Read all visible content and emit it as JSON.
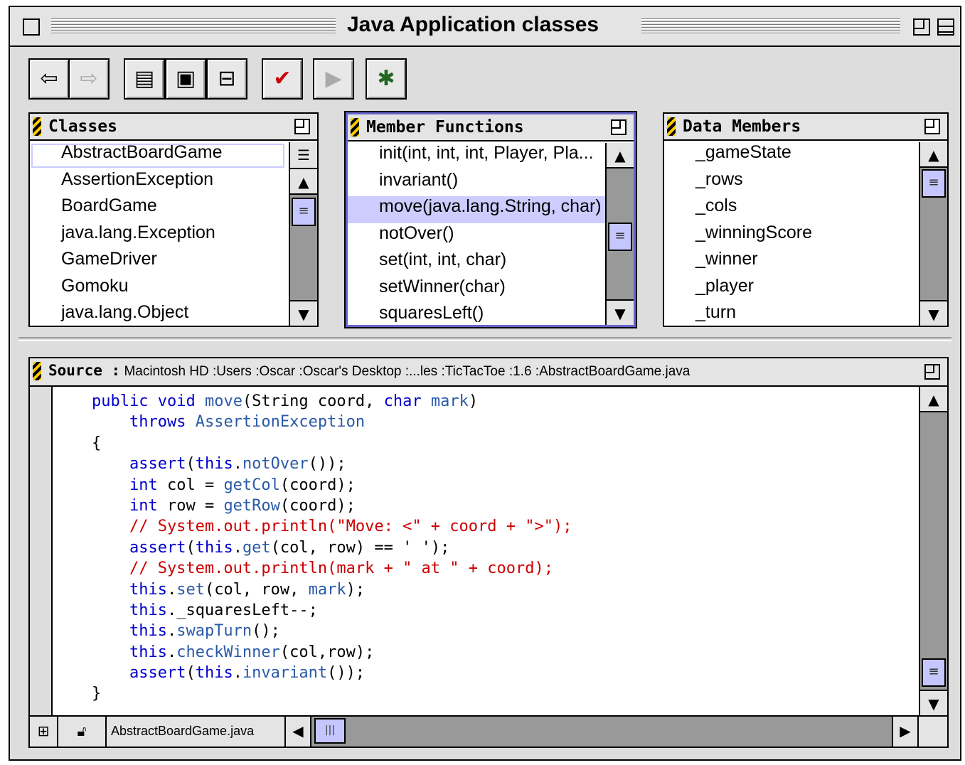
{
  "window": {
    "title": "Java Application classes"
  },
  "toolbar": {
    "buttons": [
      {
        "name": "back-button",
        "icon": "arrow-left-icon",
        "enabled": true
      },
      {
        "name": "forward-button",
        "icon": "arrow-right-icon",
        "enabled": false
      },
      {
        "name": "class-browser-button",
        "icon": "class-browser-icon",
        "enabled": true
      },
      {
        "name": "hierarchy-button",
        "icon": "hierarchy-icon",
        "enabled": true
      },
      {
        "name": "layout-button",
        "icon": "layout-icon",
        "enabled": true
      },
      {
        "name": "checklist-button",
        "icon": "checklist-icon",
        "enabled": true
      },
      {
        "name": "record-button",
        "icon": "record-icon",
        "enabled": false
      },
      {
        "name": "bug-button",
        "icon": "bug-icon",
        "enabled": true
      }
    ]
  },
  "classes": {
    "header": "Classes",
    "items": [
      "AbstractBoardGame",
      "AssertionException",
      "BoardGame",
      "java.lang.Exception",
      "GameDriver",
      "Gomoku",
      "java.lang.Object"
    ]
  },
  "member_functions": {
    "header": "Member Functions",
    "items": [
      "init(int, int, int, Player, Pla...",
      "invariant()",
      "move(java.lang.String, char)",
      "notOver()",
      "set(int, int, char)",
      "setWinner(char)",
      "squaresLeft()"
    ],
    "selected_index": 2
  },
  "data_members": {
    "header": "Data Members",
    "items": [
      "_gameState",
      "_rows",
      "_cols",
      "_winningScore",
      "_winner",
      "_player",
      "_turn"
    ]
  },
  "source": {
    "label": "Source :",
    "path": "Macintosh HD :Users :Oscar :Oscar's Desktop :...les :TicTacToe :1.6 :AbstractBoardGame.java",
    "file_tab": "AbstractBoardGame.java",
    "code": [
      "    public void move(String coord, char mark)",
      "        throws AssertionException",
      "    {",
      "        assert(this.notOver());",
      "        int col = getCol(coord);",
      "        int row = getRow(coord);",
      "        // System.out.println(\"Move: <\" + coord + \">\");",
      "        assert(this.get(col, row) == ' ');",
      "        // System.out.println(mark + \" at \" + coord);",
      "        this.set(col, row, mark);",
      "        this._squaresLeft--;",
      "        this.swapTurn();",
      "        this.checkWinner(col,row);",
      "        assert(this.invariant());",
      "    }"
    ]
  },
  "colors": {
    "selection": "#ccccff",
    "keyword": "#0000cc",
    "identifier": "#2a5aa8",
    "comment": "#cc0000",
    "chrome": "#dddddd"
  }
}
